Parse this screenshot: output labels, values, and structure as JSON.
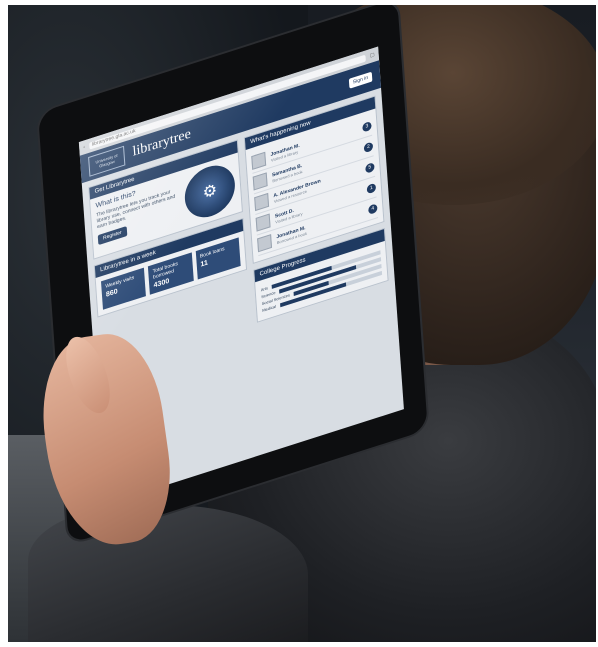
{
  "scene": {
    "description_alt": "Person holding a tablet showing the librarytree website"
  },
  "tablet": {
    "browser": {
      "url": "librarytree.gla.ac.uk"
    },
    "site": {
      "logo_text": "University of Glasgow",
      "title": "librarytree",
      "top_button": "Sign in"
    },
    "intro_panel": {
      "heading": "Get Librarytree",
      "subheading": "What is this?",
      "body": "The librarytree lets you track your library use, connect with others and earn badges.",
      "button": "Register"
    },
    "activity_panel": {
      "heading": "What's happening now",
      "items": [
        {
          "name": "Jonathan M.",
          "detail": "Visited a library",
          "badge": "3"
        },
        {
          "name": "Samantha B.",
          "detail": "Borrowed a book",
          "badge": "2"
        },
        {
          "name": "A. Alexander Brown",
          "detail": "Viewed a resource",
          "badge": "5"
        },
        {
          "name": "Scott D.",
          "detail": "Visited a library",
          "badge": "1"
        },
        {
          "name": "Jonathan M.",
          "detail": "Borrowed a book",
          "badge": "4"
        }
      ]
    },
    "week_panel": {
      "heading": "Librarytree in a week",
      "stats": [
        {
          "label": "Weekly visits",
          "value": "860"
        },
        {
          "label": "Total books borrowed",
          "value": "4300"
        },
        {
          "label": "Book loans",
          "value": "11"
        }
      ]
    },
    "progress_panel": {
      "heading": "College Progress",
      "rows": [
        {
          "label": "Arts",
          "fraction": 0.55
        },
        {
          "label": "Science",
          "fraction": 0.75
        },
        {
          "label": "Social Sciences",
          "fraction": 0.4
        },
        {
          "label": "Medical",
          "fraction": 0.65
        }
      ]
    }
  }
}
